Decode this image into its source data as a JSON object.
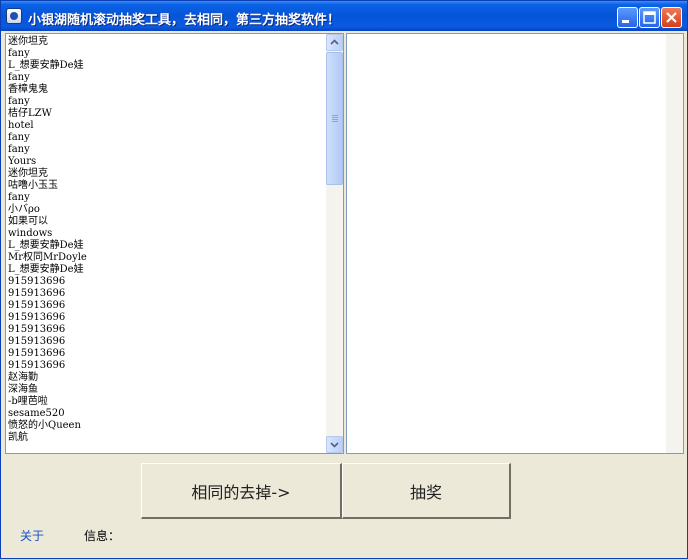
{
  "window": {
    "title": "小银湖随机滚动抽奖工具，去相同，第三方抽奖软件！"
  },
  "titlebar_buttons": {
    "minimize": "minimize-icon",
    "maximize": "maximize-icon",
    "close": "close-icon"
  },
  "entries": [
    "迷你坦克",
    "fany",
    "L_想要安静De娃",
    "fany",
    "香樟鬼鬼",
    "fany",
    "桔仔LZW",
    "hotel",
    "fany",
    "fany",
    "Yours",
    "迷你坦克",
    "咕噜小玉玉",
    "fany",
    "小バρο",
    "如果可以",
    "windows",
    "L_想要安静De娃",
    "Mr权同MrDoyle",
    "L_想要安静De娃",
    "915913696",
    "915913696",
    "915913696",
    "915913696",
    "915913696",
    "915913696",
    "915913696",
    "915913696",
    "赵海勤",
    "深海鱼",
    "-b哩芭啦",
    "sesame520",
    "愤怒的小Queen",
    "凯航"
  ],
  "buttons": {
    "dedupe": "相同的去掉->",
    "draw": "抽奖"
  },
  "footer": {
    "about": "关于",
    "info_label": "信息：",
    "info_value": ""
  },
  "colors": {
    "titlebar": "#0654d8",
    "window_bg": "#ece9d8",
    "link": "#1750c8"
  }
}
